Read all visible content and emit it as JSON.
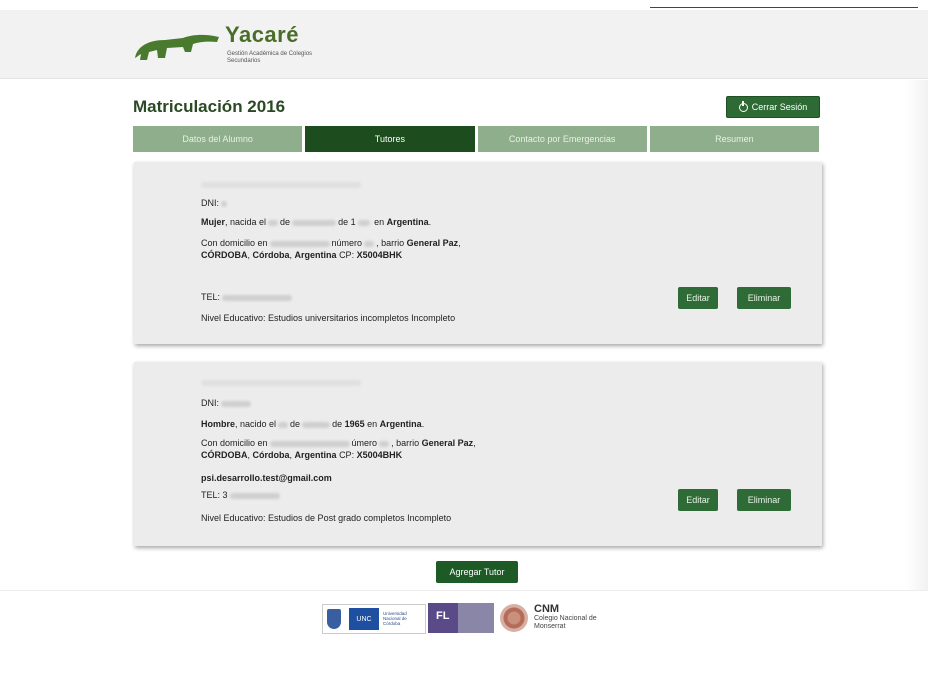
{
  "header": {
    "brand": "Yacaré",
    "brand_subtitle": "Gestión Académica de Colegios Secundarios"
  },
  "page_title": "Matriculación 2016",
  "logout_label": "Cerrar Sesión",
  "tabs": [
    {
      "label": "Datos del Alumno",
      "active": false
    },
    {
      "label": "Tutores",
      "active": true
    },
    {
      "label": "Contacto por Emergencias",
      "active": false
    },
    {
      "label": "Resumen",
      "active": false
    }
  ],
  "tutors": [
    {
      "dni_label": "DNI:",
      "sex": "Mujer",
      "born_text": ", nacida el",
      "born_mid": "de",
      "born_year_prefix": "de 1",
      "born_country_prefix": "en",
      "country": "Argentina",
      "address_prefix": "Con domicilio en",
      "address_mid": "número",
      "address_barrio": ", barrio",
      "barrio": "General Paz",
      "city": "CÓRDOBA",
      "province": "Córdoba",
      "country2": "Argentina",
      "cp_label": "CP:",
      "cp": "X5004BHK",
      "email": "",
      "tel_label": "TEL:",
      "education": "Nivel Educativo: Estudios universitarios incompletos Incompleto",
      "edit_label": "Editar",
      "delete_label": "Eliminar"
    },
    {
      "dni_label": "DNI:",
      "sex": "Hombre",
      "born_text": ", nacido el",
      "born_mid": "de",
      "born_year_prefix": "de",
      "born_year": "1965",
      "born_country_prefix": "en",
      "country": "Argentina",
      "address_prefix": "Con domicilio en",
      "address_mid": "úmero",
      "address_barrio": ", barrio",
      "barrio": "General Paz",
      "city": "CÓRDOBA",
      "province": "Córdoba",
      "country2": "Argentina",
      "cp_label": "CP:",
      "cp": "X5004BHK",
      "email": "psi.desarrollo.test@gmail.com",
      "tel_label": "TEL: 3",
      "education": "Nivel Educativo: Estudios de Post grado completos Incompleto",
      "edit_label": "Editar",
      "delete_label": "Eliminar"
    }
  ],
  "add_tutor_label": "Agregar Tutor",
  "footer": {
    "unc_label": "UNC",
    "unc_text": "Universidad Nacional de Córdoba",
    "fl_label": "FL",
    "cnm_title": "CNM",
    "cnm_subtitle": "Colegio Nacional de Monserrat"
  }
}
